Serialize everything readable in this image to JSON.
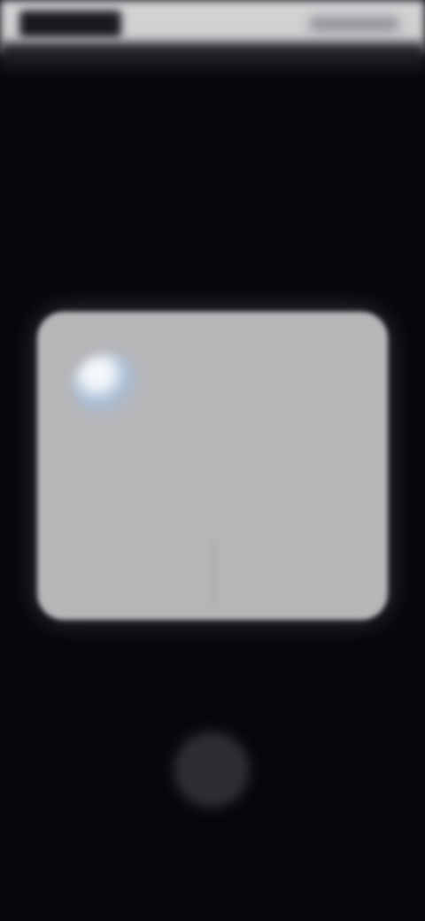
{
  "colors": {
    "background": "#07070b",
    "status_bar": "#d0d0d3",
    "dialog_background": "#b6b6b9",
    "icon_accent": "#a7bcd4"
  },
  "status_bar": {
    "time": "",
    "indicators": ""
  },
  "header": {
    "title": "",
    "subtitle": ""
  },
  "dialog": {
    "icon": "app-icon",
    "title": "",
    "body": "",
    "left_button_label": "",
    "right_button_label": ""
  },
  "bottom": {
    "label": "",
    "circle_icon": "circle-button-icon",
    "caption": ""
  }
}
